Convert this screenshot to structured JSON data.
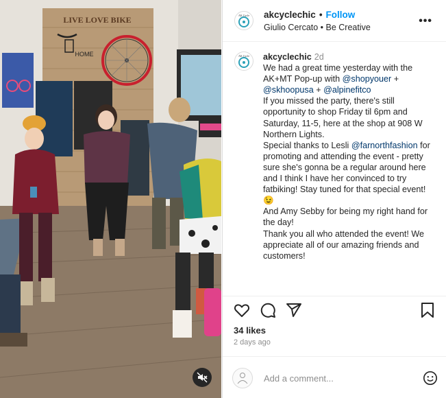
{
  "photo": {
    "wall_sign": "LIVE LOVE BIKE",
    "home_sign": "HOME",
    "mute_icon": "speaker-muted-icon"
  },
  "header": {
    "username": "akcyclechic",
    "separator": "•",
    "follow_label": "Follow",
    "subtitle": "Giulio Cercato • Be Creative",
    "more_icon": "•••"
  },
  "caption": {
    "username": "akcyclechic",
    "time": "2d",
    "p1_a": "We had a great time yesterday with the AK+MT Pop-up with ",
    "mention1": "@shopyouer",
    "p1_b": " + ",
    "mention2": "@skhoopusa",
    "p1_c": " + ",
    "mention3": "@alpinefitco",
    "p2": "If you missed the party, there's still opportunity to shop Friday til 6pm and Saturday, 11-5, here at the shop at 908 W Northern Lights.",
    "p3_a": "Special thanks to Lesli ",
    "mention4": "@farnorthfashion",
    "p3_b": " for promoting and attending the event - pretty sure she's gonna be a regular around here and I think I have her convinced to try fatbiking! Stay tuned for that special event! 😉",
    "p4": "And Amy Sebby for being my right hand for the day!",
    "p5": "Thank you all who attended the event! We appreciate all of our amazing friends and customers!"
  },
  "actions": {
    "like_icon": "heart-icon",
    "comment_icon": "comment-icon",
    "share_icon": "share-icon",
    "save_icon": "bookmark-icon"
  },
  "likes": "34 likes",
  "time_ago": "2 days ago",
  "comment": {
    "placeholder": "Add a comment...",
    "emoji_icon": "smiley-icon"
  },
  "colors": {
    "accent": "#0095f6",
    "mention": "#00376b",
    "muted": "#8e8e8e",
    "text": "#262626"
  }
}
